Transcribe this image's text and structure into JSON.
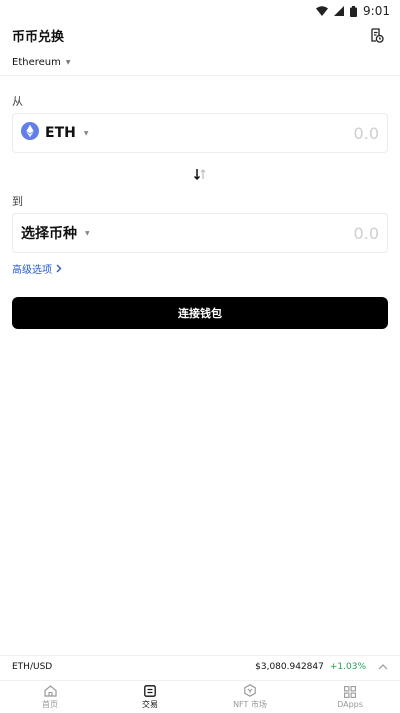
{
  "status_bar": {
    "time": "9:01"
  },
  "header": {
    "title": "币币兑换"
  },
  "network": {
    "name": "Ethereum"
  },
  "from": {
    "label": "从",
    "token": "ETH",
    "amount": "0.0"
  },
  "to": {
    "label": "到",
    "token": "选择币种",
    "amount": "0.0"
  },
  "advanced": {
    "label": "高级选项"
  },
  "connect": {
    "label": "连接钱包"
  },
  "ticker": {
    "pair": "ETH/USD",
    "price": "$3,080.942847",
    "change": "+1.03%"
  },
  "tabs": [
    {
      "label": "首页",
      "icon": "home-icon",
      "active": false
    },
    {
      "label": "交易",
      "icon": "trade-icon",
      "active": true
    },
    {
      "label": "NFT 市场",
      "icon": "nft-icon",
      "active": false
    },
    {
      "label": "DApps",
      "icon": "apps-icon",
      "active": false
    }
  ],
  "colors": {
    "accent_link": "#2a5bd7",
    "positive": "#23a05a",
    "eth_blue": "#627eea"
  }
}
